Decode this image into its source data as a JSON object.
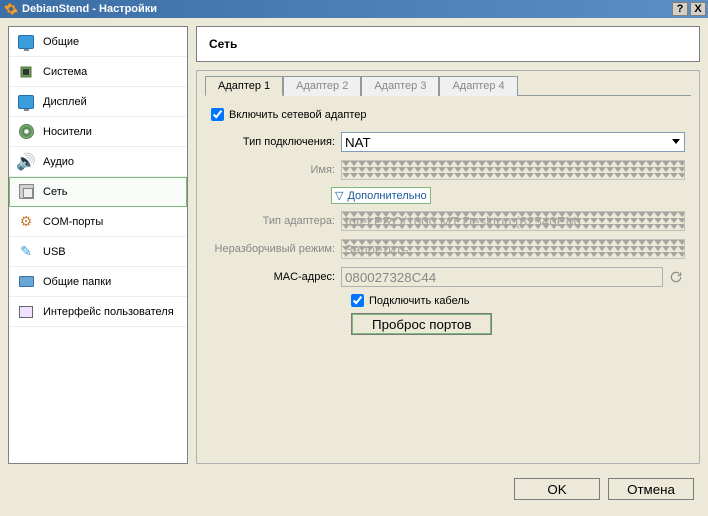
{
  "window": {
    "title": "DebianStend - Настройки",
    "help_glyph": "?",
    "close_glyph": "X"
  },
  "sidebar": {
    "items": [
      {
        "label": "Общие"
      },
      {
        "label": "Система"
      },
      {
        "label": "Дисплей"
      },
      {
        "label": "Носители"
      },
      {
        "label": "Аудио"
      },
      {
        "label": "Сеть"
      },
      {
        "label": "COM-порты"
      },
      {
        "label": "USB"
      },
      {
        "label": "Общие папки"
      },
      {
        "label": "Интерфейс пользователя"
      }
    ]
  },
  "page": {
    "header": "Сеть",
    "tabs": [
      {
        "label": "Адаптер 1"
      },
      {
        "label": "Адаптер 2"
      },
      {
        "label": "Адаптер 3"
      },
      {
        "label": "Адаптер 4"
      }
    ],
    "enable_adapter_label": "Включить сетевой адаптер",
    "conn_type_label": "Тип подключения:",
    "conn_type_value": "NAT",
    "name_label": "Имя:",
    "name_value": "",
    "advanced_label": "Дополнительно",
    "adapter_type_label": "Тип адаптера:",
    "adapter_type_value": "Intel PRO/1000 MT Desktop (82540EM)",
    "promisc_label": "Неразборчивый режим:",
    "promisc_value": "Запретить",
    "mac_label": "MAC-адрес:",
    "mac_value": "080027328C44",
    "cable_label": "Подключить кабель",
    "port_fwd_label": "Проброс портов"
  },
  "footer": {
    "ok": "OK",
    "cancel": "Отмена"
  }
}
